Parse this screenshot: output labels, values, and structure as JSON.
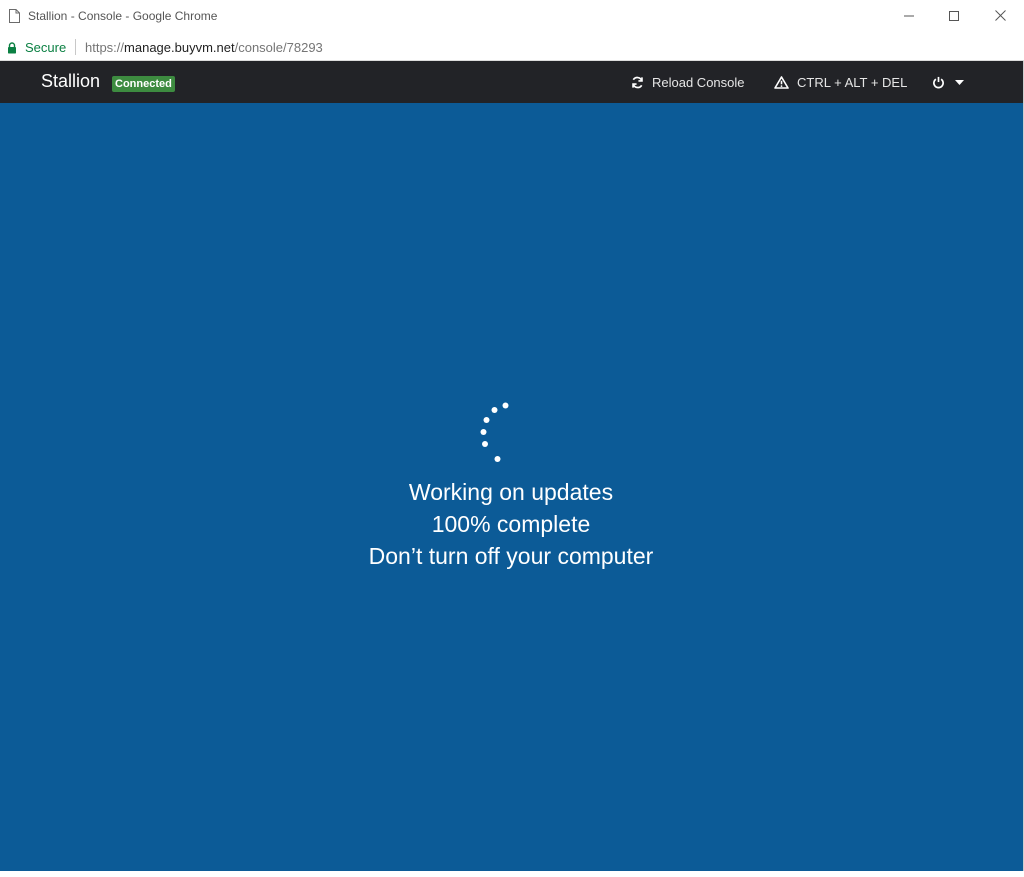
{
  "window": {
    "title": "Stallion - Console - Google Chrome",
    "controls": {
      "minimize_icon": "minimize-icon",
      "maximize_icon": "maximize-icon",
      "close_icon": "close-icon"
    }
  },
  "address_bar": {
    "secure_label": "Secure",
    "url": {
      "scheme": "https://",
      "host": "manage.buyvm.net",
      "path": "/console/78293"
    },
    "secure_color": "#0b8043"
  },
  "app_header": {
    "brand": "Stallion",
    "status_badge": "Connected",
    "badge_color": "#3d8b40",
    "background_color": "#222327",
    "reload_label": "Reload Console",
    "reload_icon": "refresh-icon",
    "cad_label": "CTRL + ALT + DEL",
    "cad_icon": "warning-icon",
    "power_icon": "power-icon",
    "power_menu_icon": "caret-down-icon"
  },
  "console": {
    "background_color": "#0c5b97",
    "spinner_icon": "loading-dots-icon",
    "lines": [
      "Working on updates",
      "100% complete",
      "Don’t turn off your computer"
    ]
  }
}
